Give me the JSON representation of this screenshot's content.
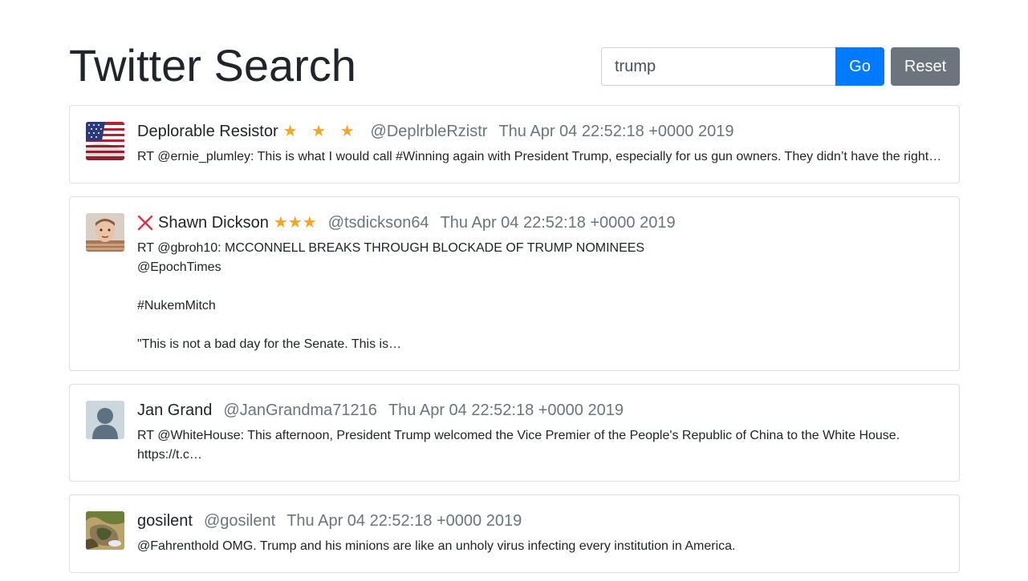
{
  "page": {
    "title": "Twitter Search"
  },
  "search": {
    "value": "trump",
    "go_label": "Go",
    "reset_label": "Reset"
  },
  "colors": {
    "primary": "#007bff",
    "secondary": "#6c757d",
    "star": "#f5a623",
    "x_mark": "#dc3545"
  },
  "tweets": [
    {
      "name": "Deplorable Resistor",
      "stars": "★ ★ ★",
      "handle": "@DeplrbleRzistr",
      "date": "Thu Apr 04 22:52:18 +0000 2019",
      "text": "RT @ernie_plumley: This is what I would call #Winning again with President Trump, especially for us gun owners. They didn’t have the right…",
      "avatar": "american-flag"
    },
    {
      "name": "Shawn Dickson",
      "stars": "★★★",
      "handle": "@tsdickson64",
      "date": "Thu Apr 04 22:52:18 +0000 2019",
      "text": "RT @gbroh10: MCCONNELL BREAKS THROUGH BLOCKADE OF TRUMP NOMINEES\n@EpochTimes\n\n#NukemMitch\n\n\"This is not a bad day for the Senate. This is…",
      "avatar": "child-photo",
      "flag_icon": "x-mark-icon"
    },
    {
      "name": "Jan Grand",
      "handle": "@JanGrandma71216",
      "date": "Thu Apr 04 22:52:18 +0000 2019",
      "text": "RT @WhiteHouse: This afternoon, President Trump welcomed the Vice Premier of the People's Republic of China to the White House.\nhttps://t.c…",
      "avatar": "default-avatar"
    },
    {
      "name": "gosilent",
      "handle": "@gosilent",
      "date": "Thu Apr 04 22:52:18 +0000 2019",
      "text": "@Fahrenthold OMG. Trump and his minions are like an unholy virus infecting every institution in America.",
      "avatar": "nature-photo"
    }
  ]
}
